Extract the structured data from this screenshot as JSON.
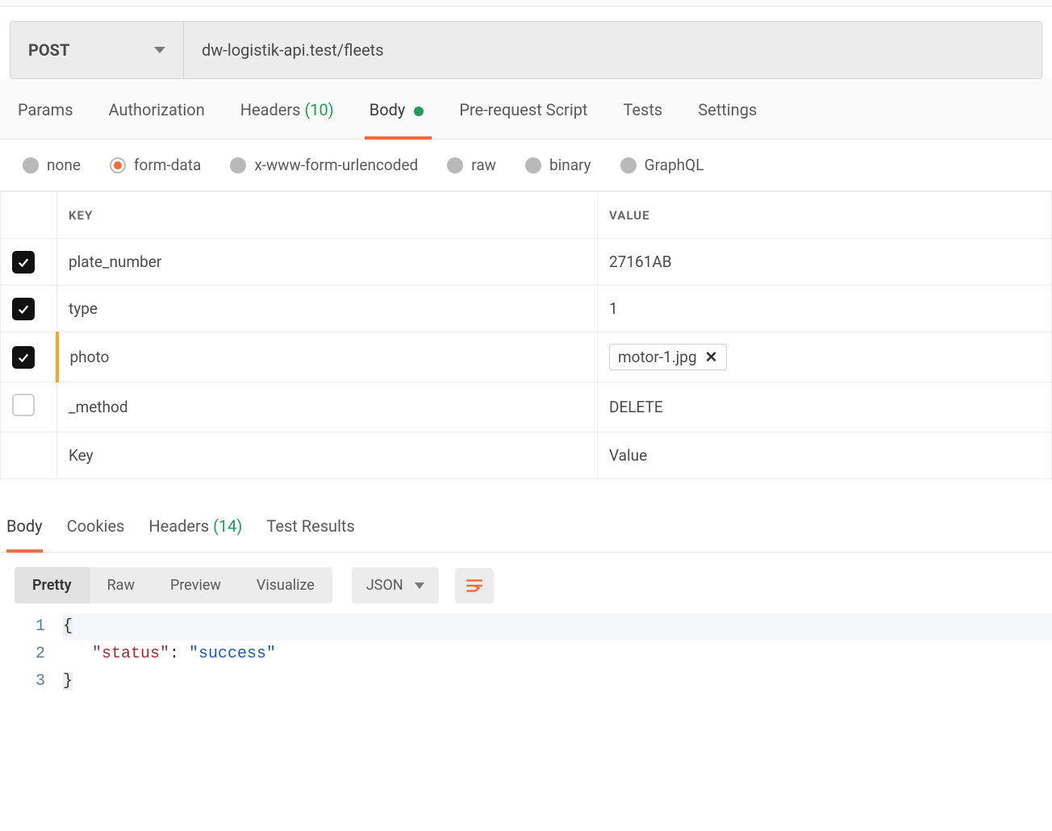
{
  "request": {
    "method": "POST",
    "url": "dw-logistik-api.test/fleets"
  },
  "req_tabs": {
    "params": "Params",
    "authorization": "Authorization",
    "headers": "Headers",
    "headers_count": "(10)",
    "body": "Body",
    "prerequest": "Pre-request Script",
    "tests": "Tests",
    "settings": "Settings",
    "active": "body"
  },
  "body_types": {
    "none": "none",
    "form_data": "form-data",
    "xwww": "x-www-form-urlencoded",
    "raw": "raw",
    "binary": "binary",
    "graphql": "GraphQL",
    "selected": "form_data"
  },
  "form_data": {
    "headers": {
      "key": "KEY",
      "value": "VALUE"
    },
    "rows": [
      {
        "checked": true,
        "key": "plate_number",
        "value": "27161AB",
        "is_file": false,
        "highlight": false,
        "disabled": false
      },
      {
        "checked": true,
        "key": "type",
        "value": "1",
        "is_file": false,
        "highlight": false,
        "disabled": false
      },
      {
        "checked": true,
        "key": "photo",
        "value": "motor-1.jpg",
        "is_file": true,
        "highlight": true,
        "disabled": false
      },
      {
        "checked": false,
        "key": "_method",
        "value": "DELETE",
        "is_file": false,
        "highlight": false,
        "disabled": true
      }
    ],
    "placeholder_key": "Key",
    "placeholder_value": "Value"
  },
  "resp_tabs": {
    "body": "Body",
    "cookies": "Cookies",
    "headers": "Headers",
    "headers_count": "(14)",
    "test_results": "Test Results",
    "active": "body"
  },
  "resp_view": {
    "pretty": "Pretty",
    "raw": "Raw",
    "preview": "Preview",
    "visualize": "Visualize",
    "active": "pretty",
    "format": "JSON"
  },
  "response_body": {
    "line1": "{",
    "line2_key": "\"status\"",
    "line2_sep": ": ",
    "line2_val": "\"success\"",
    "line3": "}",
    "gutter": [
      "1",
      "2",
      "3"
    ]
  }
}
